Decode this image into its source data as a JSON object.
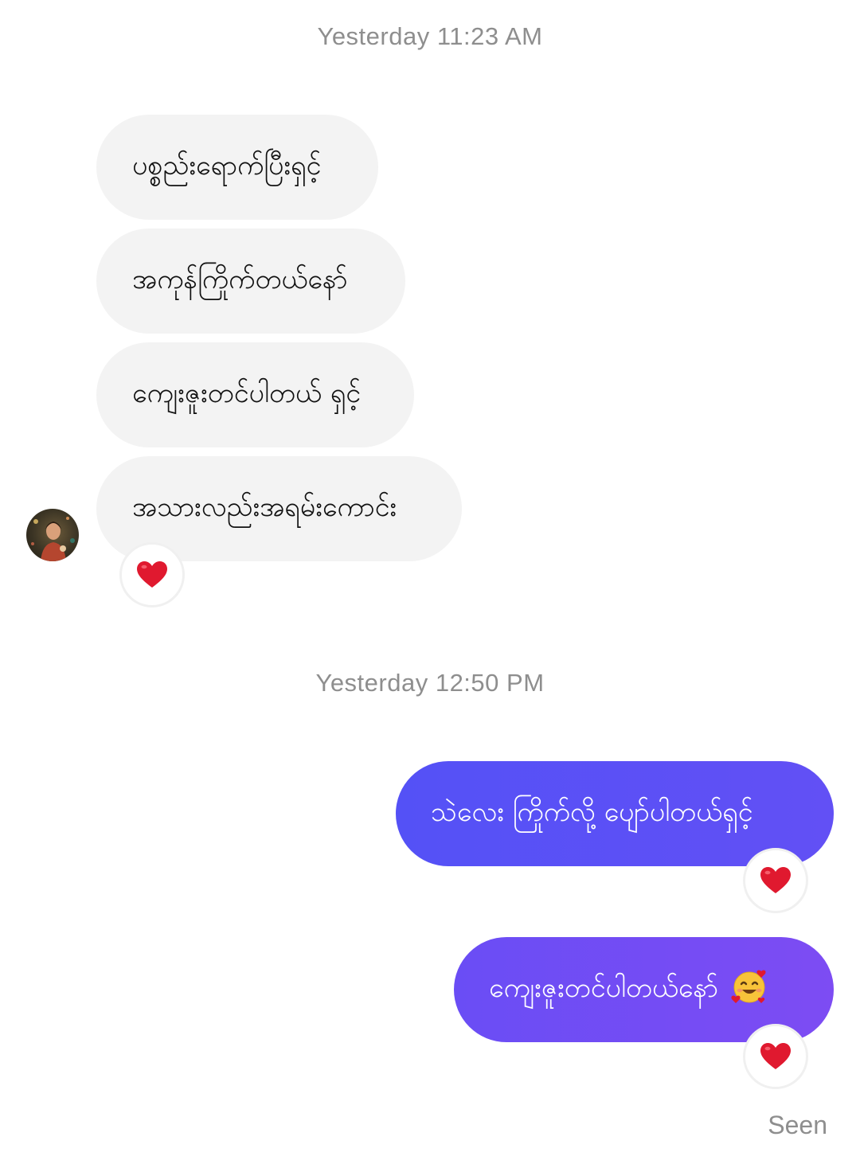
{
  "timestamps": [
    "Yesterday 11:23 AM",
    "Yesterday 12:50 PM"
  ],
  "incoming": [
    "ပစ္စည်းရောက်ပြီးရှင့်",
    "အကုန်ကြိုက်တယ်နော်",
    "ကျေးဇူးတင်ပါတယ် ရှင့်",
    "အသားလည်းအရမ်းကောင်း"
  ],
  "outgoing": [
    "သဲလေး ကြိုက်လို့ ပျော်ပါတယ်ရှင့်",
    "ကျေးဇူးတင်ပါတယ်နော်"
  ],
  "reactions": {
    "incoming_last": "heart",
    "outgoing_1": "heart",
    "outgoing_2": "heart"
  },
  "status": "Seen",
  "colors": {
    "incoming_bubble": "#f3f3f3",
    "outgoing_top": "#5b52f4",
    "outgoing_bottom": "#7a4cf3",
    "heart": "#e0192f",
    "meta_text": "#8e8e8e"
  }
}
